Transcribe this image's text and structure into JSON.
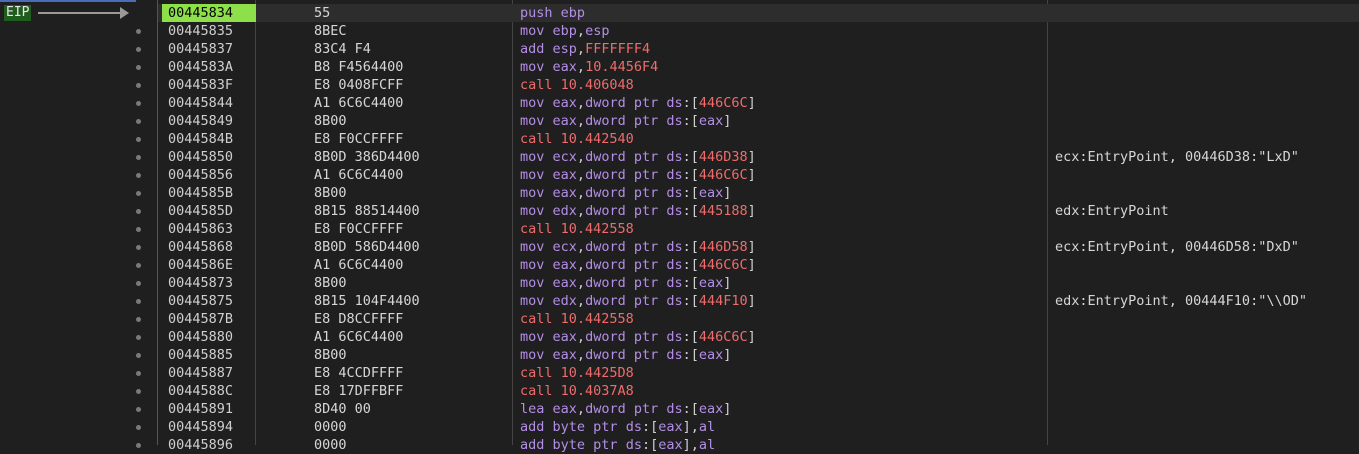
{
  "eip_label": "EIP",
  "rows": [
    {
      "addr": "00445834",
      "bytes": "55",
      "instr": [
        [
          "mn",
          "push"
        ],
        [
          "sp",
          " "
        ],
        [
          "reg",
          "ebp"
        ]
      ],
      "comment": "",
      "eip": true
    },
    {
      "addr": "00445835",
      "bytes": "8BEC",
      "instr": [
        [
          "mn",
          "mov"
        ],
        [
          "sp",
          " "
        ],
        [
          "reg",
          "ebp"
        ],
        [
          "pun",
          ","
        ],
        [
          "reg",
          "esp"
        ]
      ],
      "comment": ""
    },
    {
      "addr": "00445837",
      "bytes": "83C4 F4",
      "instr": [
        [
          "mn",
          "add"
        ],
        [
          "sp",
          " "
        ],
        [
          "reg",
          "esp"
        ],
        [
          "pun",
          ","
        ],
        [
          "num",
          "FFFFFFF4"
        ]
      ],
      "comment": ""
    },
    {
      "addr": "0044583A",
      "bytes": "B8 F4564400",
      "instr": [
        [
          "mn",
          "mov"
        ],
        [
          "sp",
          " "
        ],
        [
          "reg",
          "eax"
        ],
        [
          "pun",
          ","
        ],
        [
          "num",
          "10.4456F4"
        ]
      ],
      "comment": ""
    },
    {
      "addr": "0044583F",
      "bytes": "E8 0408FCFF",
      "instr": [
        [
          "call",
          "call"
        ],
        [
          "sp",
          " "
        ],
        [
          "num",
          "10.406048"
        ]
      ],
      "comment": ""
    },
    {
      "addr": "00445844",
      "bytes": "A1 6C6C4400",
      "instr": [
        [
          "mn",
          "mov"
        ],
        [
          "sp",
          " "
        ],
        [
          "reg",
          "eax"
        ],
        [
          "pun",
          ","
        ],
        [
          "kw",
          "dword ptr"
        ],
        [
          "sp",
          " "
        ],
        [
          "reg",
          "ds"
        ],
        [
          "pun",
          ":["
        ],
        [
          "num",
          "446C6C"
        ],
        [
          "pun",
          "]"
        ]
      ],
      "comment": ""
    },
    {
      "addr": "00445849",
      "bytes": "8B00",
      "instr": [
        [
          "mn",
          "mov"
        ],
        [
          "sp",
          " "
        ],
        [
          "reg",
          "eax"
        ],
        [
          "pun",
          ","
        ],
        [
          "kw",
          "dword ptr"
        ],
        [
          "sp",
          " "
        ],
        [
          "reg",
          "ds"
        ],
        [
          "pun",
          ":["
        ],
        [
          "reg",
          "eax"
        ],
        [
          "pun",
          "]"
        ]
      ],
      "comment": ""
    },
    {
      "addr": "0044584B",
      "bytes": "E8 F0CCFFFF",
      "instr": [
        [
          "call",
          "call"
        ],
        [
          "sp",
          " "
        ],
        [
          "num",
          "10.442540"
        ]
      ],
      "comment": ""
    },
    {
      "addr": "00445850",
      "bytes": "8B0D 386D4400",
      "instr": [
        [
          "mn",
          "mov"
        ],
        [
          "sp",
          " "
        ],
        [
          "reg",
          "ecx"
        ],
        [
          "pun",
          ","
        ],
        [
          "kw",
          "dword ptr"
        ],
        [
          "sp",
          " "
        ],
        [
          "reg",
          "ds"
        ],
        [
          "pun",
          ":["
        ],
        [
          "num",
          "446D38"
        ],
        [
          "pun",
          "]"
        ]
      ],
      "comment": "ecx:EntryPoint, 00446D38:\"LxD\""
    },
    {
      "addr": "00445856",
      "bytes": "A1 6C6C4400",
      "instr": [
        [
          "mn",
          "mov"
        ],
        [
          "sp",
          " "
        ],
        [
          "reg",
          "eax"
        ],
        [
          "pun",
          ","
        ],
        [
          "kw",
          "dword ptr"
        ],
        [
          "sp",
          " "
        ],
        [
          "reg",
          "ds"
        ],
        [
          "pun",
          ":["
        ],
        [
          "num",
          "446C6C"
        ],
        [
          "pun",
          "]"
        ]
      ],
      "comment": ""
    },
    {
      "addr": "0044585B",
      "bytes": "8B00",
      "instr": [
        [
          "mn",
          "mov"
        ],
        [
          "sp",
          " "
        ],
        [
          "reg",
          "eax"
        ],
        [
          "pun",
          ","
        ],
        [
          "kw",
          "dword ptr"
        ],
        [
          "sp",
          " "
        ],
        [
          "reg",
          "ds"
        ],
        [
          "pun",
          ":["
        ],
        [
          "reg",
          "eax"
        ],
        [
          "pun",
          "]"
        ]
      ],
      "comment": ""
    },
    {
      "addr": "0044585D",
      "bytes": "8B15 88514400",
      "instr": [
        [
          "mn",
          "mov"
        ],
        [
          "sp",
          " "
        ],
        [
          "reg",
          "edx"
        ],
        [
          "pun",
          ","
        ],
        [
          "kw",
          "dword ptr"
        ],
        [
          "sp",
          " "
        ],
        [
          "reg",
          "ds"
        ],
        [
          "pun",
          ":["
        ],
        [
          "num",
          "445188"
        ],
        [
          "pun",
          "]"
        ]
      ],
      "comment": "edx:EntryPoint"
    },
    {
      "addr": "00445863",
      "bytes": "E8 F0CCFFFF",
      "instr": [
        [
          "call",
          "call"
        ],
        [
          "sp",
          " "
        ],
        [
          "num",
          "10.442558"
        ]
      ],
      "comment": ""
    },
    {
      "addr": "00445868",
      "bytes": "8B0D 586D4400",
      "instr": [
        [
          "mn",
          "mov"
        ],
        [
          "sp",
          " "
        ],
        [
          "reg",
          "ecx"
        ],
        [
          "pun",
          ","
        ],
        [
          "kw",
          "dword ptr"
        ],
        [
          "sp",
          " "
        ],
        [
          "reg",
          "ds"
        ],
        [
          "pun",
          ":["
        ],
        [
          "num",
          "446D58"
        ],
        [
          "pun",
          "]"
        ]
      ],
      "comment": "ecx:EntryPoint, 00446D58:\"DxD\""
    },
    {
      "addr": "0044586E",
      "bytes": "A1 6C6C4400",
      "instr": [
        [
          "mn",
          "mov"
        ],
        [
          "sp",
          " "
        ],
        [
          "reg",
          "eax"
        ],
        [
          "pun",
          ","
        ],
        [
          "kw",
          "dword ptr"
        ],
        [
          "sp",
          " "
        ],
        [
          "reg",
          "ds"
        ],
        [
          "pun",
          ":["
        ],
        [
          "num",
          "446C6C"
        ],
        [
          "pun",
          "]"
        ]
      ],
      "comment": ""
    },
    {
      "addr": "00445873",
      "bytes": "8B00",
      "instr": [
        [
          "mn",
          "mov"
        ],
        [
          "sp",
          " "
        ],
        [
          "reg",
          "eax"
        ],
        [
          "pun",
          ","
        ],
        [
          "kw",
          "dword ptr"
        ],
        [
          "sp",
          " "
        ],
        [
          "reg",
          "ds"
        ],
        [
          "pun",
          ":["
        ],
        [
          "reg",
          "eax"
        ],
        [
          "pun",
          "]"
        ]
      ],
      "comment": ""
    },
    {
      "addr": "00445875",
      "bytes": "8B15 104F4400",
      "instr": [
        [
          "mn",
          "mov"
        ],
        [
          "sp",
          " "
        ],
        [
          "reg",
          "edx"
        ],
        [
          "pun",
          ","
        ],
        [
          "kw",
          "dword ptr"
        ],
        [
          "sp",
          " "
        ],
        [
          "reg",
          "ds"
        ],
        [
          "pun",
          ":["
        ],
        [
          "num",
          "444F10"
        ],
        [
          "pun",
          "]"
        ]
      ],
      "comment": "edx:EntryPoint, 00444F10:\"\\\\OD\""
    },
    {
      "addr": "0044587B",
      "bytes": "E8 D8CCFFFF",
      "instr": [
        [
          "call",
          "call"
        ],
        [
          "sp",
          " "
        ],
        [
          "num",
          "10.442558"
        ]
      ],
      "comment": ""
    },
    {
      "addr": "00445880",
      "bytes": "A1 6C6C4400",
      "instr": [
        [
          "mn",
          "mov"
        ],
        [
          "sp",
          " "
        ],
        [
          "reg",
          "eax"
        ],
        [
          "pun",
          ","
        ],
        [
          "kw",
          "dword ptr"
        ],
        [
          "sp",
          " "
        ],
        [
          "reg",
          "ds"
        ],
        [
          "pun",
          ":["
        ],
        [
          "num",
          "446C6C"
        ],
        [
          "pun",
          "]"
        ]
      ],
      "comment": ""
    },
    {
      "addr": "00445885",
      "bytes": "8B00",
      "instr": [
        [
          "mn",
          "mov"
        ],
        [
          "sp",
          " "
        ],
        [
          "reg",
          "eax"
        ],
        [
          "pun",
          ","
        ],
        [
          "kw",
          "dword ptr"
        ],
        [
          "sp",
          " "
        ],
        [
          "reg",
          "ds"
        ],
        [
          "pun",
          ":["
        ],
        [
          "reg",
          "eax"
        ],
        [
          "pun",
          "]"
        ]
      ],
      "comment": ""
    },
    {
      "addr": "00445887",
      "bytes": "E8 4CCDFFFF",
      "instr": [
        [
          "call",
          "call"
        ],
        [
          "sp",
          " "
        ],
        [
          "num",
          "10.4425D8"
        ]
      ],
      "comment": ""
    },
    {
      "addr": "0044588C",
      "bytes": "E8 17DFFBFF",
      "instr": [
        [
          "call",
          "call"
        ],
        [
          "sp",
          " "
        ],
        [
          "num",
          "10.4037A8"
        ]
      ],
      "comment": ""
    },
    {
      "addr": "00445891",
      "bytes": "8D40 00",
      "instr": [
        [
          "mn",
          "lea"
        ],
        [
          "sp",
          " "
        ],
        [
          "reg",
          "eax"
        ],
        [
          "pun",
          ","
        ],
        [
          "kw",
          "dword ptr"
        ],
        [
          "sp",
          " "
        ],
        [
          "reg",
          "ds"
        ],
        [
          "pun",
          ":["
        ],
        [
          "reg",
          "eax"
        ],
        [
          "pun",
          "]"
        ]
      ],
      "comment": ""
    },
    {
      "addr": "00445894",
      "bytes": "0000",
      "instr": [
        [
          "mn",
          "add"
        ],
        [
          "sp",
          " "
        ],
        [
          "kw",
          "byte ptr"
        ],
        [
          "sp",
          " "
        ],
        [
          "reg",
          "ds"
        ],
        [
          "pun",
          ":["
        ],
        [
          "reg",
          "eax"
        ],
        [
          "pun",
          "],"
        ],
        [
          "reg",
          "al"
        ]
      ],
      "comment": ""
    },
    {
      "addr": "00445896",
      "bytes": "0000",
      "instr": [
        [
          "mn",
          "add"
        ],
        [
          "sp",
          " "
        ],
        [
          "kw",
          "byte ptr"
        ],
        [
          "sp",
          " "
        ],
        [
          "reg",
          "ds"
        ],
        [
          "pun",
          ":["
        ],
        [
          "reg",
          "eax"
        ],
        [
          "pun",
          "],"
        ],
        [
          "reg",
          "al"
        ]
      ],
      "comment": ""
    }
  ],
  "colors": {
    "background": "#1f1f1f",
    "eip_highlight": "#8ee04a",
    "mnemonic": "#b48ee6",
    "call": "#f06b6b",
    "number": "#f06b6b",
    "text": "#d6d6d6"
  }
}
